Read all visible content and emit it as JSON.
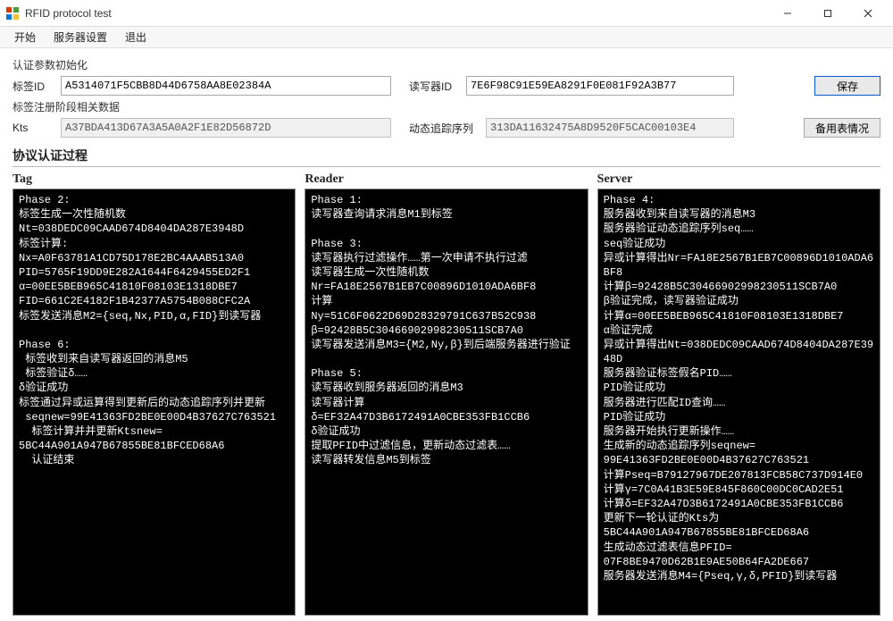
{
  "window": {
    "title": "RFID protocol test"
  },
  "menu": {
    "start": "开始",
    "server_settings": "服务器设置",
    "exit": "退出"
  },
  "auth_params": {
    "group_title": "认证参数初始化",
    "tag_id_label": "标签ID",
    "tag_id_value": "A5314071F5CBB8D44D6758AA8E02384A",
    "reader_id_label": "读写器ID",
    "reader_id_value": "7E6F98C91E59EA8291F0E081F92A3B77",
    "save_label": "保存"
  },
  "reg_phase": {
    "group_title": "标签注册阶段相关数据",
    "kts_label": "Kts",
    "kts_value": "A37BDA413D67A3A5A0A2F1E82D56872D",
    "dts_label": "动态追踪序列",
    "dts_value": "313DA11632475A8D9520F5CAC00103E4",
    "backup_label": "备用表情况"
  },
  "process": {
    "header": "协议认证过程",
    "tag_title": "Tag",
    "reader_title": "Reader",
    "server_title": "Server"
  },
  "console": {
    "tag": "Phase 2:\n标签生成一次性随机数\nNt=038DEDC09CAAD674D8404DA287E3948D\n标签计算:\nNx=A0F63781A1CD75D178E2BC4AAAB513A0\nPID=5765F19DD9E282A1644F6429455ED2F1\nα=00EE5BEB965C41810F08103E1318DBE7\nFID=661C2E4182F1B42377A5754B088CFC2A\n标签发送消息M2={seq,Nx,PID,α,FID}到读写器\n\nPhase 6:\n 标签收到来自读写器返回的消息M5\n 标签验证δ……\nδ验证成功\n标签通过异或运算得到更新后的动态追踪序列并更新\n seqnew=99E41363FD2BE0E00D4B37627C763521\n  标签计算并并更新Ktsnew=\n5BC44A901A947B67855BE81BFCED68A6\n  认证结束",
    "reader": "Phase 1:\n读写器查询请求消息M1到标签\n\nPhase 3:\n读写器执行过滤操作……第一次申请不执行过滤\n读写器生成一次性随机数\nNr=FA18E2567B1EB7C00896D1010ADA6BF8\n计算\nNy=51C6F0622D69D28329791C637B52C938\nβ=92428B5C30466902998230511SCB7A0\n读写器发送消息M3={M2,Ny,β}到后端服务器进行验证\n\nPhase 5:\n读写器收到服务器返回的消息M3\n读写器计算\nδ=EF32A47D3B6172491A0CBE353FB1CCB6\nδ验证成功\n提取PFID中过滤信息，更新动态过滤表……\n读写器转发信息M5到标签",
    "server": "Phase 4:\n服务器收到来自读写器的消息M3\n服务器验证动态追踪序列seq……\nseq验证成功\n异或计算得出Nr=FA18E2567B1EB7C00896D1010ADA6BF8\n计算β=92428B5C30466902998230511SCB7A0\nβ验证完成，读写器验证成功\n计算α=00EE5BEB965C41810F08103E1318DBE7\nα验证完成\n异或计算得出Nt=038DEDC09CAAD674D8404DA287E3948D\n服务器验证标签假名PID……\nPID验证成功\n服务器进行匹配ID查询……\nPID验证成功\n服务器开始执行更新操作……\n生成新的动态追踪序列seqnew=\n99E41363FD2BE0E00D4B37627C763521\n计算Pseq=B79127967DE207813FCB58C737D914E0\n计算γ=7C0A41B3E59E845F860C00DC0CAD2E51\n计算δ=EF32A47D3B6172491A0CBE353FB1CCB6\n更新下一轮认证的Kts为\n5BC44A901A947B67855BE81BFCED68A6\n生成动态过滤表信息PFID=\n07F8BE9470D62B1E9AE50B64FA2DE667\n服务器发送消息M4={Pseq,γ,δ,PFID}到读写器"
  }
}
